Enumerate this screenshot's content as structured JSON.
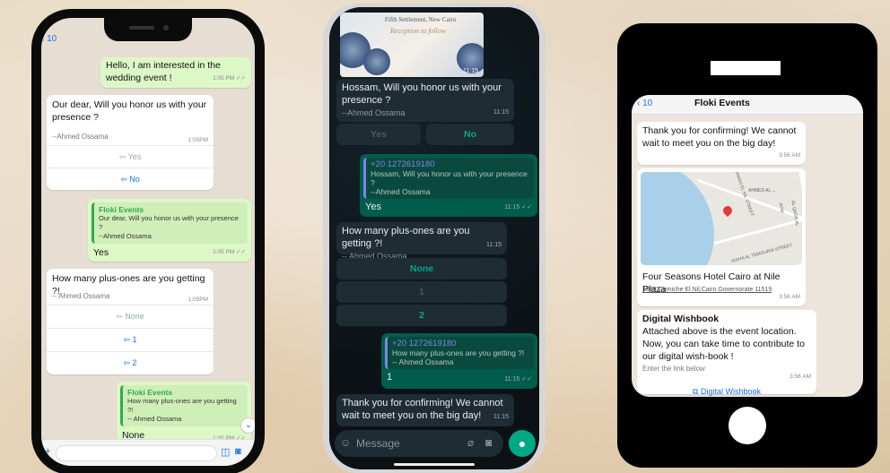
{
  "colors": {
    "wa_green": "#00a884",
    "out_bubble_light": "#dcf8c6",
    "out_bubble_dark": "#005c4b",
    "link_blue": "#1a73e8"
  },
  "phone1": {
    "back_count": "10",
    "msg_interest": {
      "text": "Hello, I am interested in the wedding event !",
      "time": "1:05 PM"
    },
    "msg_honor": {
      "text": "Our dear, Will you honor us with your presence ?",
      "signature": "--Ahmed Ossama",
      "time": "1:05PM",
      "options": [
        "Yes",
        "No"
      ]
    },
    "reply_yes": {
      "quote_name": "Floki Events",
      "quote_text": "Our dear, Will you honor us with your presence ?",
      "quote_sig": "--Ahmed Ossama",
      "text": "Yes",
      "time": "1:05 PM"
    },
    "msg_plus": {
      "text": "How many plus-ones are you getting ?!",
      "signature": "-- Ahmed Ossama",
      "time": "1:05PM",
      "options": [
        "None",
        "1",
        "2"
      ]
    },
    "reply_none": {
      "quote_name": "Floki Events",
      "quote_text": "How many plus-ones are you getting ?!",
      "quote_sig": "-- Ahmed Ossama",
      "text": "None",
      "time": "1:05 PM"
    }
  },
  "phone2": {
    "card": {
      "location": "Fifth Settlement, New Cairo",
      "script": "Reception to follow",
      "time": "11:15"
    },
    "msg_honor": {
      "text": "Hossam, Will you honor us with your presence ?",
      "signature": "--Ahmed Ossama",
      "time": "11:15",
      "options": [
        "Yes",
        "No"
      ]
    },
    "reply_yes": {
      "quote_name": "+20 1272619180",
      "quote_text": "Hossam, Will you honor us with your presence ?",
      "quote_sig": "--Ahmed Ossama",
      "text": "Yes",
      "time": "11:15"
    },
    "msg_plus": {
      "text": "How many plus-ones are you getting ?!",
      "signature": "-- Ahmed Ossama",
      "time": "11:15",
      "options": [
        "None",
        "1",
        "2"
      ]
    },
    "reply_one": {
      "quote_name": "+20 1272619180",
      "quote_text": "How many plus-ones are you getting ?!",
      "quote_sig": "-- Ahmed Ossama",
      "text": "1",
      "time": "11:15"
    },
    "msg_confirm": {
      "text": "Thank you for confirming! We cannot wait to meet you on the big day!",
      "time": "11:15"
    },
    "input_placeholder": "Message"
  },
  "phone3": {
    "back_count": "10",
    "contact_name": "Floki Events",
    "msg_confirm": {
      "text": "Thank you for confirming! We cannot wait to meet you on the big day!",
      "time": "3:56 AM"
    },
    "location": {
      "title": "Four Seasons Hotel Cairo at Nile Plaza",
      "address": "1089 Corniche El Nil,Cairo Governorate 11519",
      "time": "3:56 AM",
      "map_labels": [
        "KORNISH EL NIL STREET",
        "AHMED AL ...",
        "AL QASR AL AYNI",
        "AISHA AL TEMOURIA STREET"
      ]
    },
    "wishbook": {
      "title": "Digital Wishbook",
      "text": "Attached above is the event location. Now, you can take time to contribute to our digital wish-book !",
      "footer": "Enter the link below",
      "time": "3:56 AM",
      "button": "Digital Wishbook"
    }
  }
}
